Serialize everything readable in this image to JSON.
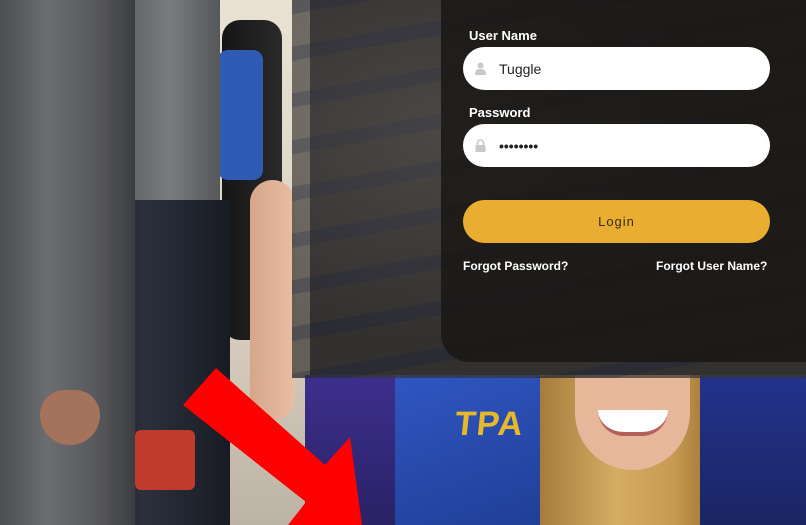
{
  "login": {
    "username_label": "User Name",
    "username_value": "Tuggle",
    "password_label": "Password",
    "password_value": "••••••••",
    "login_button": "Login",
    "forgot_password": "Forgot Password?",
    "forgot_username": "Forgot User Name?"
  },
  "background": {
    "shirt_text": "TPA"
  },
  "icons": {
    "username_icon": "user-icon",
    "password_icon": "lock-icon",
    "annotation": "red-arrow-icon"
  },
  "colors": {
    "accent": "#e8ad31",
    "annotation_arrow": "#ff0000"
  }
}
